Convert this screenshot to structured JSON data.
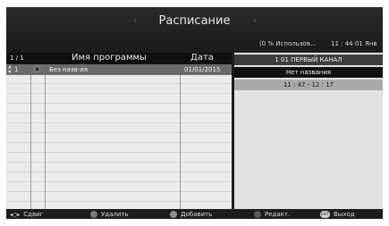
{
  "header": {
    "title": "Расписание",
    "left_arrow": "‹",
    "right_arrow": "›"
  },
  "status": {
    "usage": "(0 % Использов...",
    "clock": "11 : 44  01 Янв"
  },
  "list": {
    "page_count": "1 / 1",
    "col_name": "Имя программы",
    "col_date": "Дата",
    "rows": [
      {
        "num": "1",
        "name": "Без назв-ия",
        "date": "01/01/2015"
      }
    ]
  },
  "details": {
    "channel": "1 01 ПЕРВЫЙ КАНАЛ",
    "program": "Нет названия",
    "time": "11 : 47 - 12 : 17"
  },
  "footer": {
    "move_arrows": "◂○▸",
    "move": "Сдвиг",
    "delete": "Удалить",
    "add": "Добавить",
    "edit": "Редакт.",
    "exit_badge": "EXIT",
    "exit": "Выход"
  }
}
